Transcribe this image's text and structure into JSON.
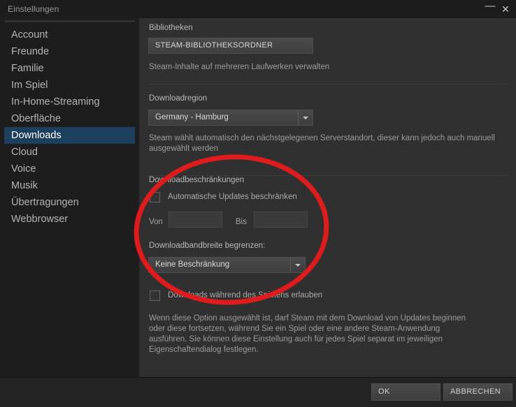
{
  "window": {
    "title": "Einstellungen",
    "minimize_label": "—",
    "close_label": "✕"
  },
  "sidebar": {
    "items": [
      {
        "label": "Account",
        "selected": false
      },
      {
        "label": "Freunde",
        "selected": false
      },
      {
        "label": "Familie",
        "selected": false
      },
      {
        "label": "Im Spiel",
        "selected": false
      },
      {
        "label": "In-Home-Streaming",
        "selected": false
      },
      {
        "label": "Oberfläche",
        "selected": false
      },
      {
        "label": "Downloads",
        "selected": true
      },
      {
        "label": "Cloud",
        "selected": false
      },
      {
        "label": "Voice",
        "selected": false
      },
      {
        "label": "Musik",
        "selected": false
      },
      {
        "label": "Übertragungen",
        "selected": false
      },
      {
        "label": "Webbrowser",
        "selected": false
      }
    ]
  },
  "content": {
    "libraries": {
      "section_label": "Bibliotheken",
      "button_label": "STEAM-BIBLIOTHEKSORDNER",
      "help": "Steam-Inhalte auf mehreren Laufwerken verwalten"
    },
    "download_region": {
      "section_label": "Downloadregion",
      "selected_value": "Germany - Hamburg",
      "help": "Steam wählt automatisch den nächstgelegenen Serverstandort, dieser kann jedoch auch manuell ausgewählt werden"
    },
    "download_restrictions": {
      "section_label": "Downloadbeschränkungen",
      "limit_updates_label": "Automatische Updates beschränken",
      "limit_updates_checked": false,
      "from_label": "Von",
      "from_value": "",
      "to_label": "Bis",
      "to_value": "",
      "bandwidth_label": "Downloadbandbreite begrenzen:",
      "bandwidth_value": "Keine Beschränkung",
      "allow_while_playing_label": "Downloads während des Spielens erlauben",
      "allow_while_playing_checked": false,
      "help": "Wenn diese Option ausgewählt ist, darf Steam mit dem Download von Updates beginnen oder diese fortsetzen, während Sie ein Spiel oder eine andere Steam-Anwendung ausführen. Sie können diese Einstellung auch für jedes Spiel separat im jeweiligen Eigenschaftendialog festlegen."
    }
  },
  "footer": {
    "ok_label": "OK",
    "cancel_label": "ABBRECHEN"
  },
  "annotation": {
    "shape": "ellipse-highlight",
    "color": "#e01b1b"
  }
}
